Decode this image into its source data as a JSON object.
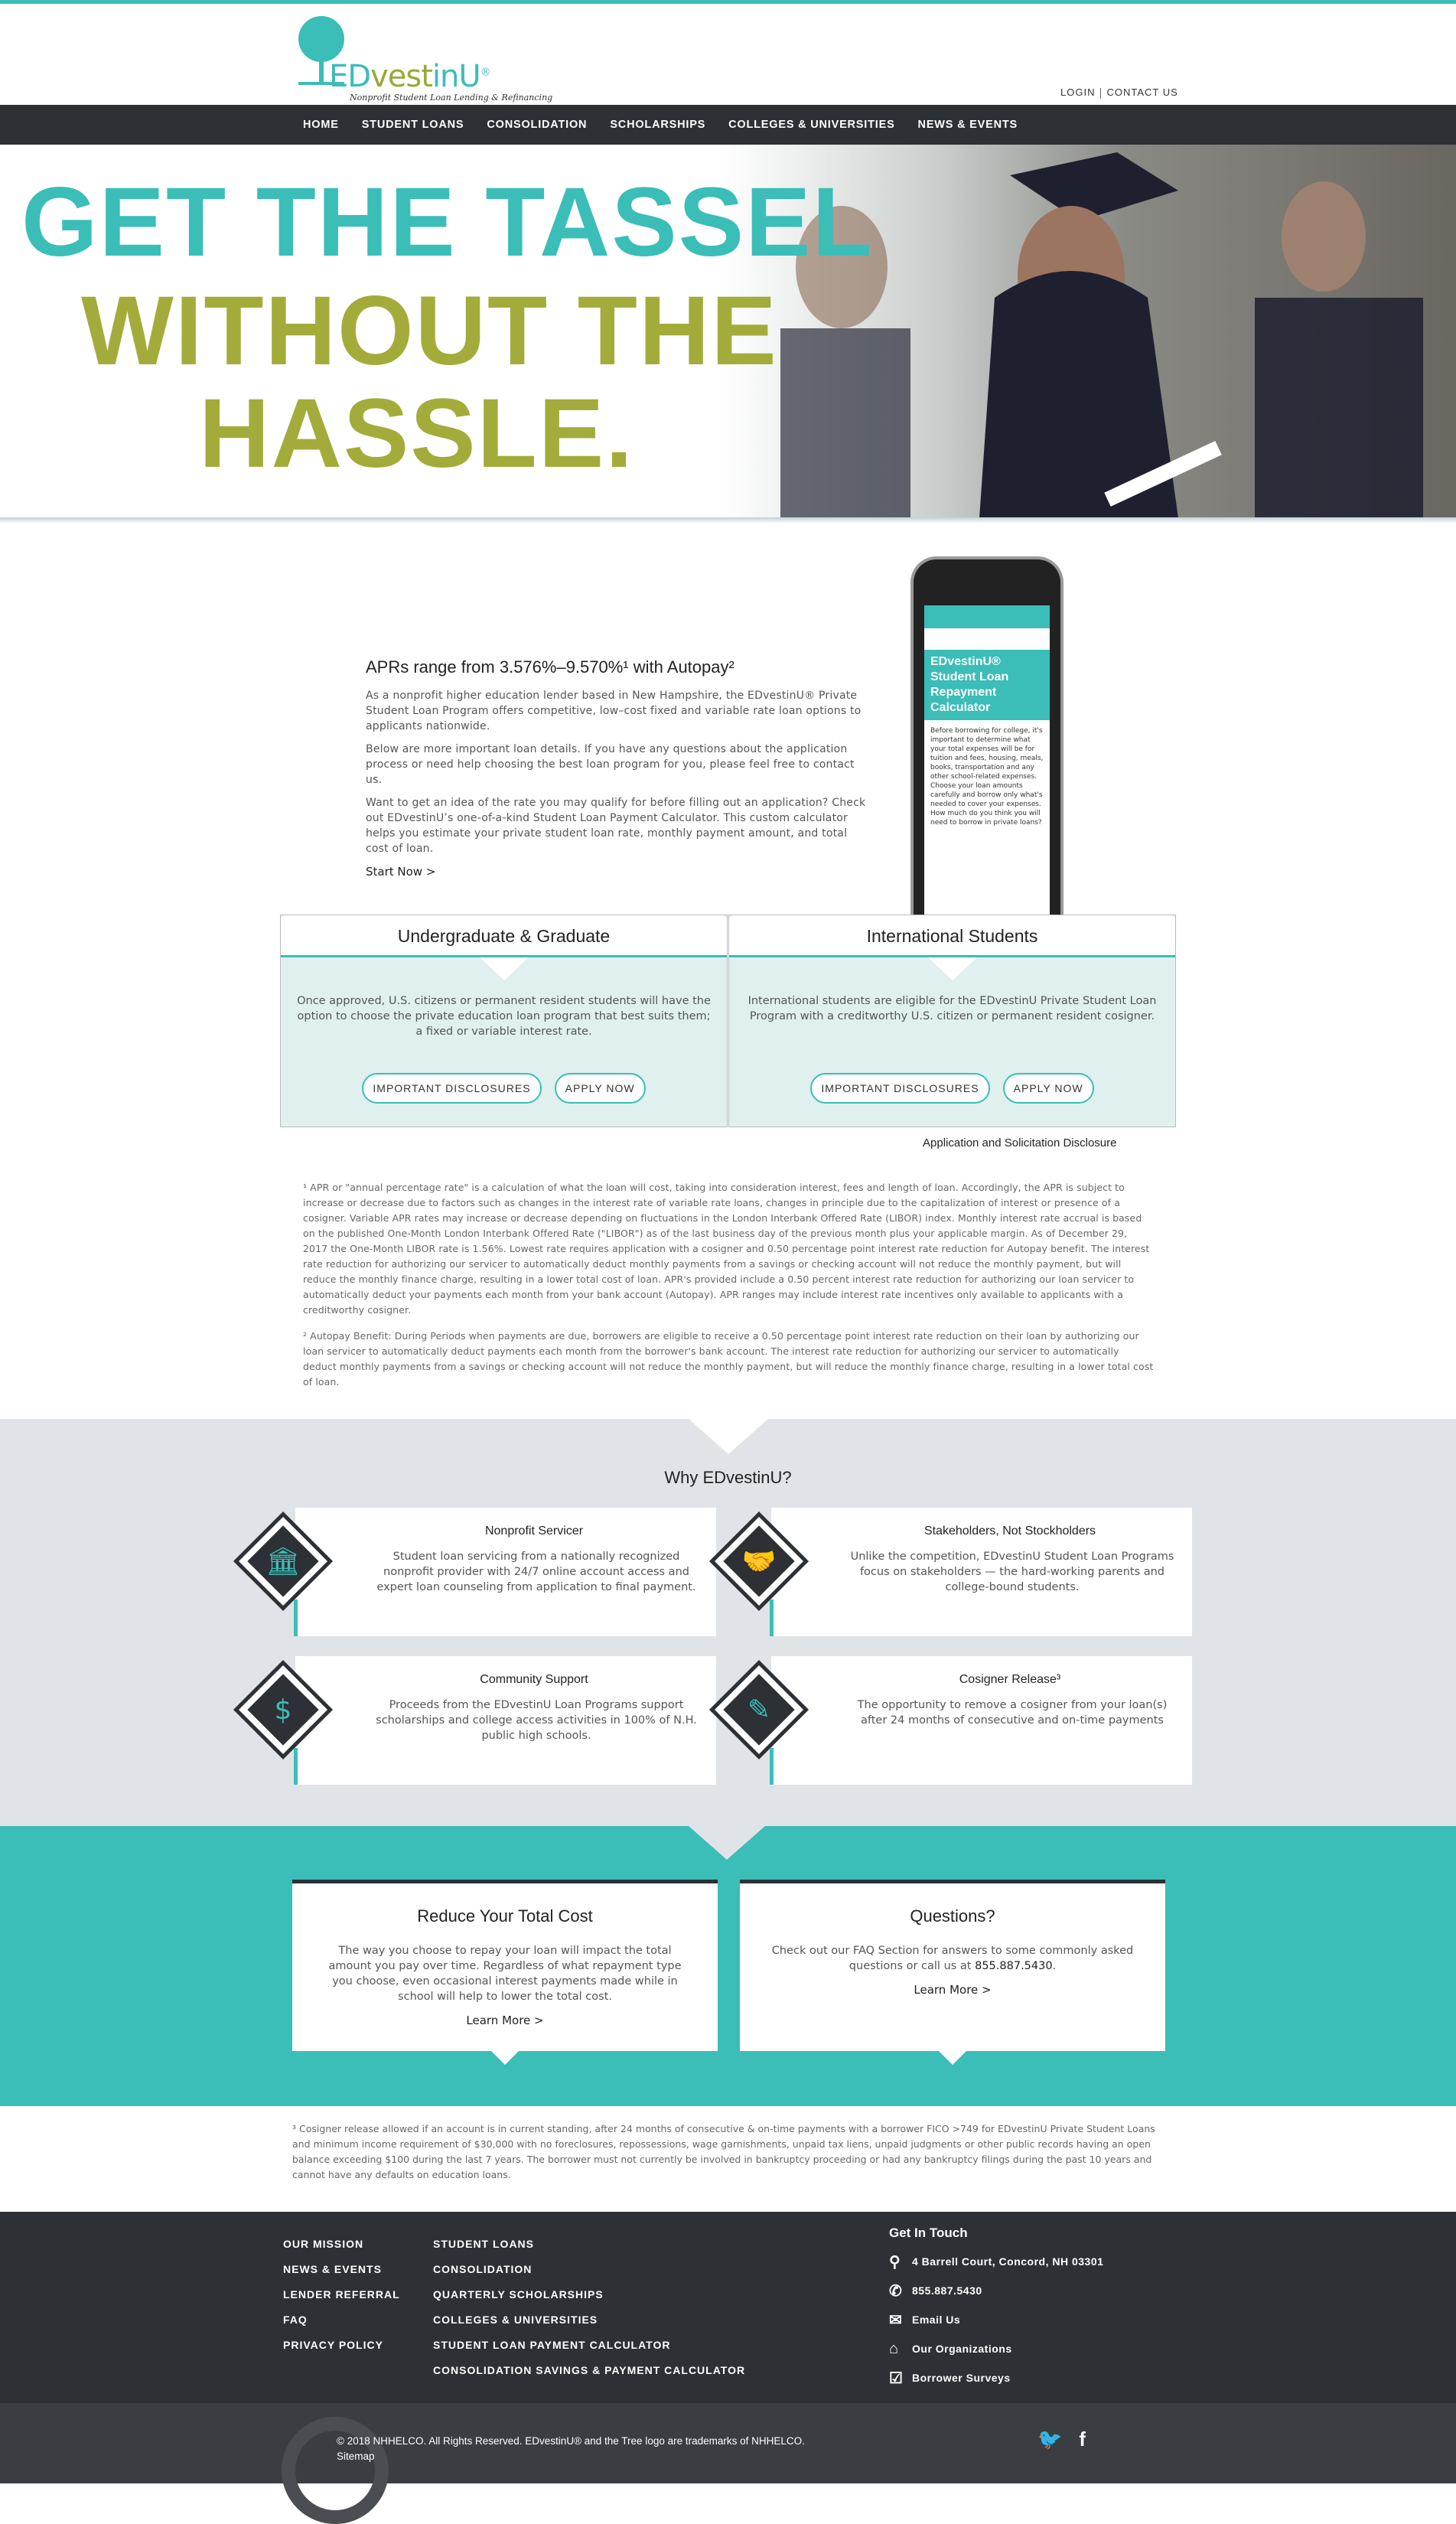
{
  "brand": {
    "logo_ed": "ED",
    "logo_vest": "vest",
    "logo_inu": "inU",
    "logo_reg": "®",
    "tagline": "Nonprofit Student Loan Lending & Refinancing"
  },
  "toplinks": {
    "login": "LOGIN",
    "contact": "CONTACT US"
  },
  "nav": [
    "HOME",
    "STUDENT LOANS",
    "CONSOLIDATION",
    "SCHOLARSHIPS",
    "COLLEGES & UNIVERSITIES",
    "NEWS & EVENTS"
  ],
  "hero": {
    "line1": "GET THE TASSEL",
    "line2": "WITHOUT THE",
    "line3": "HASSLE."
  },
  "intro": {
    "heading": "APRs range from 3.576%–9.570%¹ with Autopay²",
    "p1": "As a nonprofit higher education lender based in New Hampshire, the EDvestinU® Private Student Loan Program offers competitive, low–cost fixed and variable rate loan options to applicants nationwide.",
    "p2": "Below are more important loan details. If you have any questions about the application process or need help choosing the best loan program for you, please feel free to contact us.",
    "p3": "Want to get an idea of the rate you may qualify for before filling out an application? Check out EDvestinU’s one-of-a-kind Student Loan Payment Calculator. This custom calculator helps you estimate your private student loan rate, monthly payment amount, and total cost of loan.",
    "start_now": "Start Now >"
  },
  "phone_screen": {
    "title": "EDvestinU® Student Loan Repayment Calculator",
    "text": "Before borrowing for college, it's important to determine what your total expenses will be for tuition and fees, housing, meals, books, transportation and any other school-related expenses. Choose your loan amounts carefully and borrow only what's needed to cover your expenses. How much do you think you will need to borrow in private loans?"
  },
  "loans": [
    {
      "title": "Undergraduate & Graduate",
      "text": "Once approved, U.S. citizens or permanent resident students will have the option to choose the private education loan program that best suits them; a fixed or variable interest rate.",
      "btn1": "IMPORTANT DISCLOSURES",
      "btn2": "APPLY NOW"
    },
    {
      "title": "International Students",
      "text": "International students are eligible for the EDvestinU Private Student Loan Program with a creditworthy U.S. citizen or permanent resident cosigner.",
      "btn1": "IMPORTANT DISCLOSURES",
      "btn2": "APPLY NOW"
    }
  ],
  "app_disclosure": "Application and Solicitation Disclosure",
  "footnotes": {
    "f1": "¹ APR or \"annual percentage rate\" is a calculation of what the loan will cost, taking into consideration interest, fees and length of loan. Accordingly, the APR is subject to increase or decrease due to factors such as changes in the interest rate of variable rate loans, changes in principle due to the capitalization of interest or presence of a cosigner. Variable APR rates may increase or decrease depending on fluctuations in the London Interbank Offered Rate (LIBOR) index. Monthly interest rate accrual is based on the published One-Month London Interbank Offered Rate (\"LIBOR\") as of the last business day of the previous month plus your applicable margin. As of December 29, 2017 the One-Month LIBOR rate is 1.56%. Lowest rate requires application with a cosigner and 0.50 percentage point interest rate reduction for Autopay benefit. The interest rate reduction for authorizing our servicer to automatically deduct monthly payments from a savings or checking account will not reduce the monthly payment, but will reduce the monthly finance charge, resulting in a lower total cost of loan. APR's provided include a 0.50 percent interest rate reduction for authorizing our loan servicer to automatically deduct your payments each month from your bank account (Autopay). APR ranges may include interest rate incentives only available to applicants with a creditworthy cosigner.",
    "f2": "² Autopay Benefit: During Periods when payments are due, borrowers are eligible to receive a 0.50 percentage point interest rate reduction on their loan by authorizing our loan servicer to automatically deduct payments each month from the borrower's bank account. The interest rate reduction for authorizing our servicer to automatically deduct monthly payments from a savings or checking account will not reduce the monthly payment, but will reduce the monthly finance charge, resulting in a lower total cost of loan."
  },
  "why": {
    "heading": "Why EDvestinU?",
    "cards": [
      {
        "title": "Nonprofit Servicer",
        "body": "Student loan servicing from a nationally recognized nonprofit provider with 24/7 online account access and expert loan counseling from application to final payment.",
        "icon": "bank-icon"
      },
      {
        "title": "Stakeholders, Not Stockholders",
        "body": "Unlike the competition, EDvestinU Student Loan Programs focus on stakeholders — the hard-working parents and college-bound students.",
        "icon": "handshake-icon"
      },
      {
        "title": "Community Support",
        "body": "Proceeds from the EDvestinU Loan Programs support scholarships and college access activities in 100% of N.H. public high schools.",
        "icon": "dollar-icon"
      },
      {
        "title": "Cosigner Release³",
        "body": "The opportunity to remove a cosigner from your loan(s) after 24 months of consecutive and on-time payments",
        "icon": "pen-signature-icon"
      }
    ]
  },
  "cta": [
    {
      "title": "Reduce Your Total Cost",
      "text": "The way you choose to repay your loan will impact the total amount you pay over time. Regardless of what repayment type you choose, even occasional interest payments made while in school will help to lower the total cost.",
      "link": "Learn More >"
    },
    {
      "title": "Questions?",
      "text": "Check out our FAQ Section for answers to some commonly asked questions or call us at",
      "phone": "855.887.5430",
      "period": ".",
      "link": "Learn More >"
    }
  ],
  "footnote3": "³ Cosigner release allowed if an account is in current standing, after 24 months of consecutive & on-time payments with a borrower FICO >749 for EDvestinU Private Student Loans and minimum income requirement of $30,000 with no foreclosures, repossessions, wage garnishments, unpaid tax liens, unpaid judgments or other public records having an open balance exceeding $100 during the last 7 years. The borrower must not currently be involved in bankruptcy proceeding or had any bankruptcy filings during the past 10 years and cannot have any defaults on education loans.",
  "footer": {
    "col1": [
      "OUR MISSION",
      "NEWS & EVENTS",
      "LENDER REFERRAL",
      "FAQ",
      "PRIVACY POLICY"
    ],
    "col2": [
      "STUDENT LOANS",
      "CONSOLIDATION",
      "QUARTERLY SCHOLARSHIPS",
      "COLLEGES & UNIVERSITIES",
      "STUDENT LOAN PAYMENT CALCULATOR",
      "CONSOLIDATION SAVINGS & PAYMENT CALCULATOR"
    ],
    "get_in_touch": "Get In Touch",
    "address": "4 Barrell Court, Concord, NH 03301",
    "phone": "855.887.5430",
    "email": "Email Us",
    "orgs": "Our Organizations",
    "surveys": "Borrower Surveys"
  },
  "bottom": {
    "copyright": "© 2018 NHHELCO. All Rights Reserved. EDvestinU® and the Tree logo are trademarks of NHHELCO.",
    "sitemap": "Sitemap",
    "twitter": "twitter-icon",
    "facebook": "facebook-icon"
  }
}
